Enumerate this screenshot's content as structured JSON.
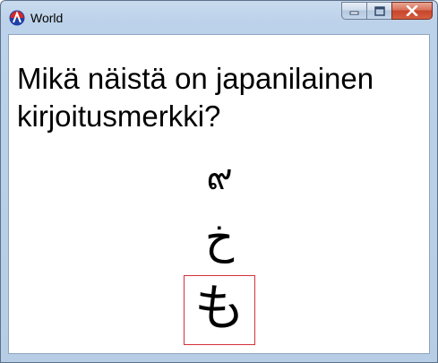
{
  "window": {
    "title": "World"
  },
  "question": "Mikä näistä on japanilainen kirjoitusmerkki?",
  "options": [
    {
      "glyph": "๙",
      "selected": false
    },
    {
      "glyph": "خ",
      "selected": false
    },
    {
      "glyph": "も",
      "selected": true
    }
  ],
  "colors": {
    "selection_border": "#d6303a",
    "close_button": "#c6452c"
  }
}
